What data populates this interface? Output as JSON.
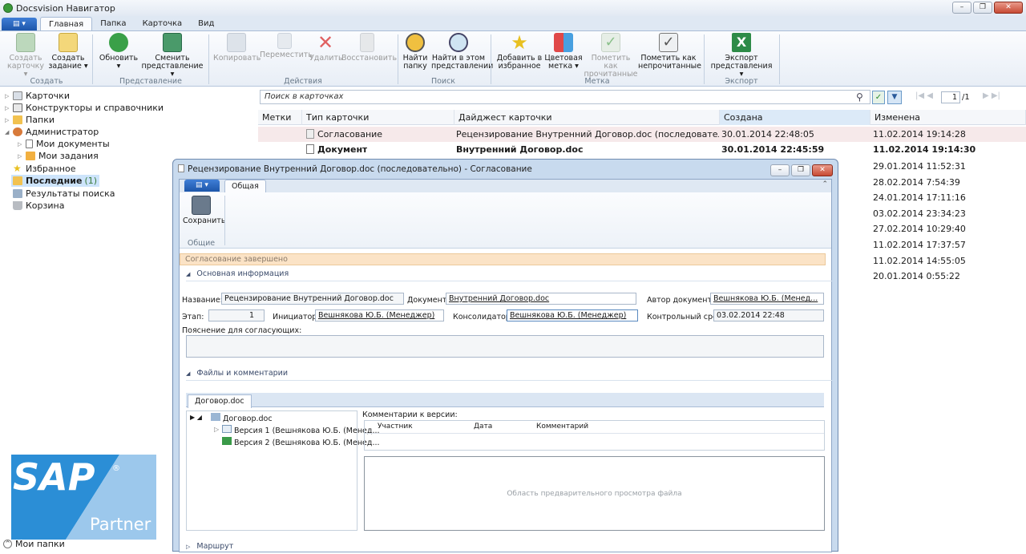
{
  "window": {
    "title": "Docsvision Навигатор"
  },
  "menu": {
    "tabs": [
      "Главная",
      "Папка",
      "Карточка",
      "Вид"
    ]
  },
  "ribbon": {
    "buttons": [
      {
        "l1": "Создать",
        "l2": "карточку ▾"
      },
      {
        "l1": "Создать",
        "l2": "задание ▾"
      },
      {
        "l1": "Обновить",
        "l2": "▾"
      },
      {
        "l1": "Сменить",
        "l2": "представление ▾"
      },
      {
        "l1": "Копировать",
        "l2": ""
      },
      {
        "l1": "Переместить",
        "l2": ""
      },
      {
        "l1": "Удалить",
        "l2": ""
      },
      {
        "l1": "Восстановить",
        "l2": ""
      },
      {
        "l1": "Найти",
        "l2": "папку"
      },
      {
        "l1": "Найти в этом",
        "l2": "представлении"
      },
      {
        "l1": "Добавить в",
        "l2": "избранное"
      },
      {
        "l1": "Цветовая",
        "l2": "метка ▾"
      },
      {
        "l1": "Пометить как",
        "l2": "прочитанные"
      },
      {
        "l1": "Пометить как",
        "l2": "непрочитанные"
      },
      {
        "l1": "Экспорт",
        "l2": "представления ▾"
      }
    ],
    "groups": [
      "Создать",
      "Представление",
      "Действия",
      "Поиск",
      "Метка",
      "Экспорт"
    ]
  },
  "tree": {
    "items": [
      "Карточки",
      "Конструкторы и справочники",
      "Папки",
      "Администратор",
      "Мои документы",
      "Мои задания",
      "Избранное",
      "Последние",
      "(1)",
      "Результаты поиска",
      "Корзина"
    ],
    "footer": "Мои папки"
  },
  "grid": {
    "search_placeholder": "Поиск в карточках",
    "page": "1",
    "page_total": "/1",
    "columns": [
      "Метки",
      "Тип карточки",
      "Дайджест карточки",
      "Создана",
      "Изменена"
    ],
    "rows": [
      {
        "type": "Согласование",
        "digest": "Рецензирование Внутренний Договор.doc (последовательн...",
        "created": "30.01.2014 22:48:05",
        "modified": "11.02.2014 19:14:28"
      },
      {
        "type": "Документ",
        "digest": "Внутренний Договор.doc",
        "created": "30.01.2014 22:45:59",
        "modified": "11.02.2014 19:14:30"
      }
    ],
    "modified_only": [
      "29.01.2014 11:52:31",
      "28.02.2014 7:54:39",
      "24.01.2014 17:11:16",
      "03.02.2014 23:34:23",
      "27.02.2014 10:29:40",
      "11.02.2014 17:37:57",
      "11.02.2014 14:55:05",
      "20.01.2014 0:55:22"
    ]
  },
  "dialog": {
    "title": "Рецензирование Внутренний Договор.doc (последовательно) - Согласование",
    "tab": "Общая",
    "save": "Сохранить",
    "group": "Общие",
    "status": "Согласование завершено",
    "section_main": "Основная информация",
    "labels": {
      "name": "Название:",
      "document": "Документ:",
      "author": "Автор документа:",
      "stage": "Этап:",
      "initiator": "Инициатор:",
      "consolidator": "Консолидатор:",
      "deadline": "Контрольный срок:",
      "comment": "Пояснение для согласующих:"
    },
    "values": {
      "name": "Рецензирование Внутренний Договор.doc",
      "document": "Внутренний Договор.doc",
      "author": "Вешнякова Ю.Б. (Менед...",
      "stage": "1",
      "initiator": "Вешнякова Ю.Б. (Менеджер)",
      "consolidator": "Вешнякова Ю.Б. (Менеджер)",
      "deadline": "03.02.2014 22:48"
    },
    "section_files": "Файлы и комментарии",
    "file_tab": "Договор.doc",
    "file_tree": [
      "Договор.doc",
      "Версия 1 (Вешнякова Ю.Б. (Менед...",
      "Версия 2 (Вешнякова Ю.Б. (Менед..."
    ],
    "comments_label": "Комментарии к версии:",
    "comment_cols": [
      "Участник",
      "Дата",
      "Комментарий"
    ],
    "preview": "Область предварительного просмотра файла",
    "section_route": "Маршрут"
  },
  "sap": {
    "brand": "SAP",
    "tm": "®",
    "partner": "Partner"
  }
}
